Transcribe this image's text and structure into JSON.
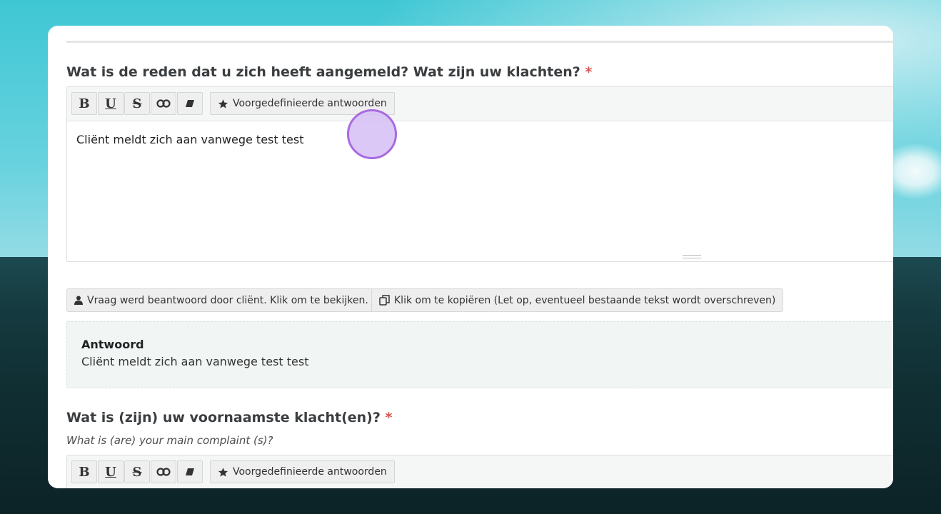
{
  "questions": [
    {
      "title": "Wat is de reden dat u zich heeft aangemeld? Wat zijn uw klachten?",
      "required_mark": "*",
      "editor": {
        "predefined_label": "Voorgedefinieerde antwoorden",
        "content": "Cliënt meldt zich aan vanwege test test"
      },
      "client_answered_label": "Vraag werd beantwoord door cliënt. Klik om te bekijken.",
      "copy_label": "Klik om te kopiëren (Let op, eventueel bestaande tekst wordt overschreven)",
      "answer": {
        "label": "Antwoord",
        "text": "Cliënt meldt zich aan vanwege test test"
      }
    },
    {
      "title": "Wat is (zijn) uw voornaamste klacht(en)?",
      "required_mark": "*",
      "subtitle": "What is (are) your main complaint (s)?",
      "editor": {
        "predefined_label": "Voorgedefinieerde antwoorden"
      }
    }
  ],
  "toolbar": {
    "bold_label": "B",
    "underline_label": "U",
    "strike_label": "S",
    "icons": [
      "link-icon",
      "eraser-icon",
      "star-icon"
    ]
  },
  "colors": {
    "required": "#d9534f",
    "answer_bg": "#f1f6f4",
    "cursor": "#a86be0"
  }
}
